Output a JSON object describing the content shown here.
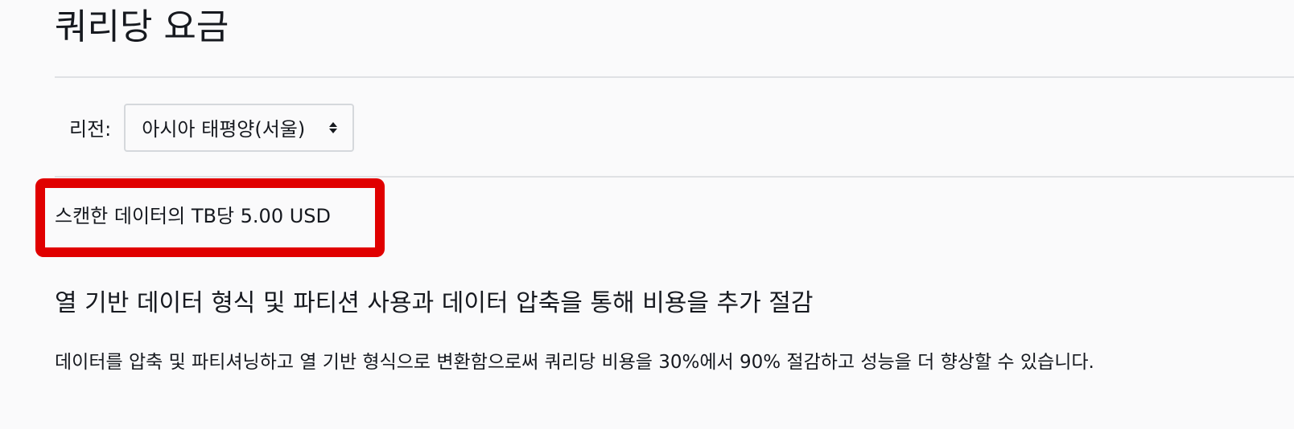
{
  "page": {
    "title": "쿼리당 요금"
  },
  "region": {
    "label": "리전:",
    "selected": "아시아 태평양(서울)",
    "icon": "sort-arrows-icon"
  },
  "pricing": {
    "text": "스캔한 데이터의 TB당 5.00 USD",
    "highlight_color": "#e00000"
  },
  "savings": {
    "heading": "열 기반 데이터 형식 및 파티션 사용과 데이터 압축을 통해 비용을 추가 절감",
    "body": "데이터를 압축 및 파티셔닝하고 열 기반 형식으로 변환함으로써 쿼리당 비용을 30%에서 90% 절감하고 성능을 더 향상할 수 있습니다."
  }
}
